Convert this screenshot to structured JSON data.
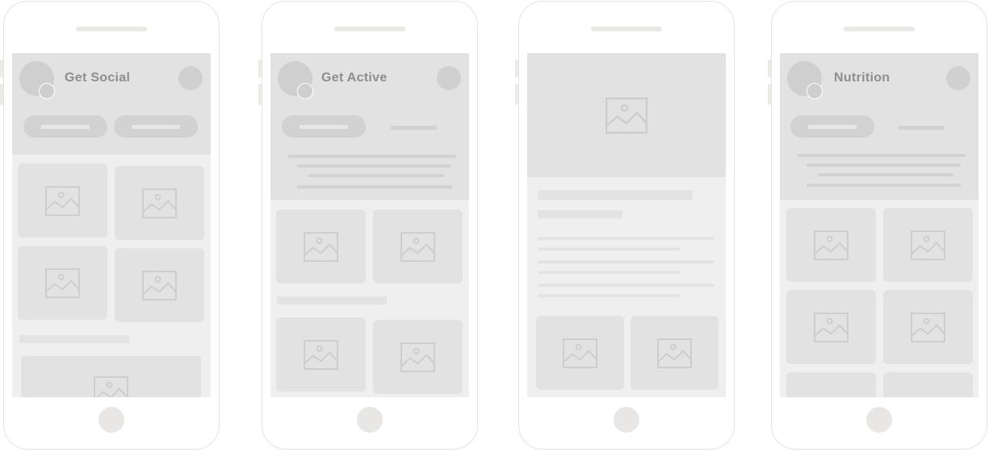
{
  "phones": [
    {
      "id": "get-social",
      "title": "Get Social",
      "tabs": [
        "tab-1",
        "tab-2"
      ]
    },
    {
      "id": "get-active",
      "title": "Get Active",
      "tabs": [
        "tab-1",
        "tab-2"
      ]
    },
    {
      "id": "detail",
      "title": "",
      "tabs": []
    },
    {
      "id": "nutrition",
      "title": "Nutrition",
      "tabs": [
        "tab-1",
        "tab-2"
      ]
    }
  ],
  "icons": {
    "image_placeholder": "image-placeholder-icon",
    "home_button": "home-button",
    "speaker": "speaker-slot"
  },
  "colors": {
    "screen_bg": "#efefef",
    "header_bg": "#e2e2e2",
    "placeholder": "#d2d2d2",
    "title_text": "#8e8e8e",
    "frame_border": "#dfe6e2"
  }
}
